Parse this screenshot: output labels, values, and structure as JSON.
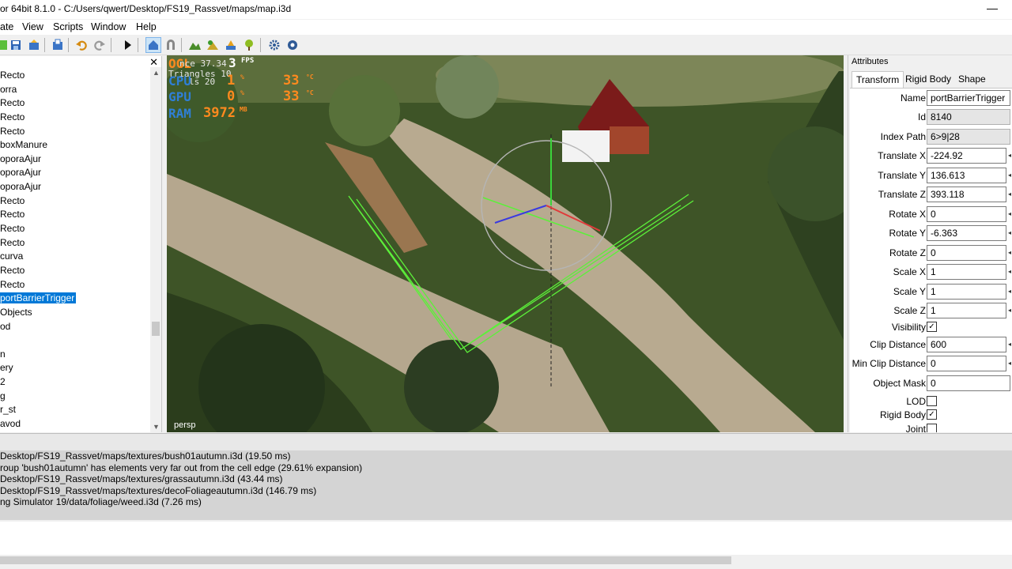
{
  "window": {
    "title": "or 64bit 8.1.0 - C:/Users/qwert/Desktop/FS19_Rassvet/maps/map.i3d",
    "minimize_glyph": "—"
  },
  "menu": [
    "ate",
    "View",
    "Scripts",
    "Window",
    "Help"
  ],
  "toolbar": {
    "icons": [
      "new-icon",
      "save-icon",
      "export-icon",
      "import-icon",
      "undo-icon",
      "redo-icon",
      "play-icon",
      "select-mode-icon",
      "magnet-icon",
      "terrain-paint-icon",
      "foliage-paint-icon",
      "texture-paint-icon",
      "tree-paint-icon",
      "settings-icon",
      "tools-icon"
    ]
  },
  "scenegraph": {
    "close_glyph": "✕",
    "items": [
      "Recto",
      "orra",
      "Recto",
      "Recto",
      "Recto",
      "boxManure",
      "oporaAjur",
      "oporaAjur",
      "oporaAjur",
      "Recto",
      "Recto",
      "Recto",
      "Recto",
      "curva",
      "Recto",
      "Recto",
      "portBarrierTrigger",
      "Objects",
      "od",
      "",
      "n",
      "ery",
      "2",
      "g",
      "r_st",
      "avod"
    ],
    "selected_index": 16
  },
  "viewport": {
    "stats": {
      "ogl_label": "OGL",
      "fps_value": "3",
      "fps_label": "FPS",
      "distance_fragment": "nce 37.34",
      "triangles_fragment": "Triangles 10",
      "draw_fragment": "ls 20",
      "cpu_label": "CPU",
      "cpu_value": "1",
      "cpu_unit": "%",
      "cpu_temp": "33",
      "gpu_label": "GPU",
      "gpu_value": "0",
      "gpu_unit": "%",
      "gpu_temp": "33",
      "temp_unit": "°C",
      "ram_label": "RAM",
      "ram_value": "3972",
      "ram_unit": "MB"
    },
    "camera_label": "persp"
  },
  "attributes": {
    "header": "Attributes",
    "tabs": [
      "Transform",
      "Rigid Body",
      "Shape"
    ],
    "active_tab": 0,
    "fields": [
      {
        "label": "Name",
        "value": "portBarrierTrigger",
        "kind": "text"
      },
      {
        "label": "Id",
        "value": "8140",
        "kind": "readonly"
      },
      {
        "label": "Index Path",
        "value": "6>9|28",
        "kind": "readonly"
      },
      {
        "label": "Translate X",
        "value": "-224.92",
        "kind": "spin"
      },
      {
        "label": "Translate Y",
        "value": "136.613",
        "kind": "spin"
      },
      {
        "label": "Translate Z",
        "value": "393.118",
        "kind": "spin"
      },
      {
        "label": "Rotate X",
        "value": "0",
        "kind": "spin"
      },
      {
        "label": "Rotate Y",
        "value": "-6.363",
        "kind": "spin"
      },
      {
        "label": "Rotate Z",
        "value": "0",
        "kind": "spin"
      },
      {
        "label": "Scale X",
        "value": "1",
        "kind": "spin"
      },
      {
        "label": "Scale Y",
        "value": "1",
        "kind": "spin"
      },
      {
        "label": "Scale Z",
        "value": "1",
        "kind": "spin"
      },
      {
        "label": "Visibility",
        "checked": true,
        "kind": "check"
      },
      {
        "label": "Clip Distance",
        "value": "600",
        "kind": "spin"
      },
      {
        "label": "Min Clip Distance",
        "value": "0",
        "kind": "spin"
      },
      {
        "label": "Object Mask",
        "value": "0",
        "kind": "text"
      },
      {
        "label": "LOD",
        "checked": false,
        "kind": "check"
      },
      {
        "label": "Rigid Body",
        "checked": true,
        "kind": "check"
      },
      {
        "label": "Joint",
        "checked": false,
        "kind": "check"
      }
    ]
  },
  "log": [
    "Desktop/FS19_Rassvet/maps/textures/bush01autumn.i3d (19.50 ms)",
    "roup 'bush01autumn' has elements very far out from the cell edge (29.61% expansion)",
    "Desktop/FS19_Rassvet/maps/textures/grassautumn.i3d (43.44 ms)",
    "Desktop/FS19_Rassvet/maps/textures/decoFoliageautumn.i3d (146.79 ms)",
    "ng Simulator 19/data/foliage/weed.i3d (7.26 ms)"
  ],
  "colors": {
    "selection": "#0078d7",
    "stat_blue": "#2f7fd6",
    "stat_orange": "#ff8a1e",
    "trigger_green": "#5cf03a"
  }
}
